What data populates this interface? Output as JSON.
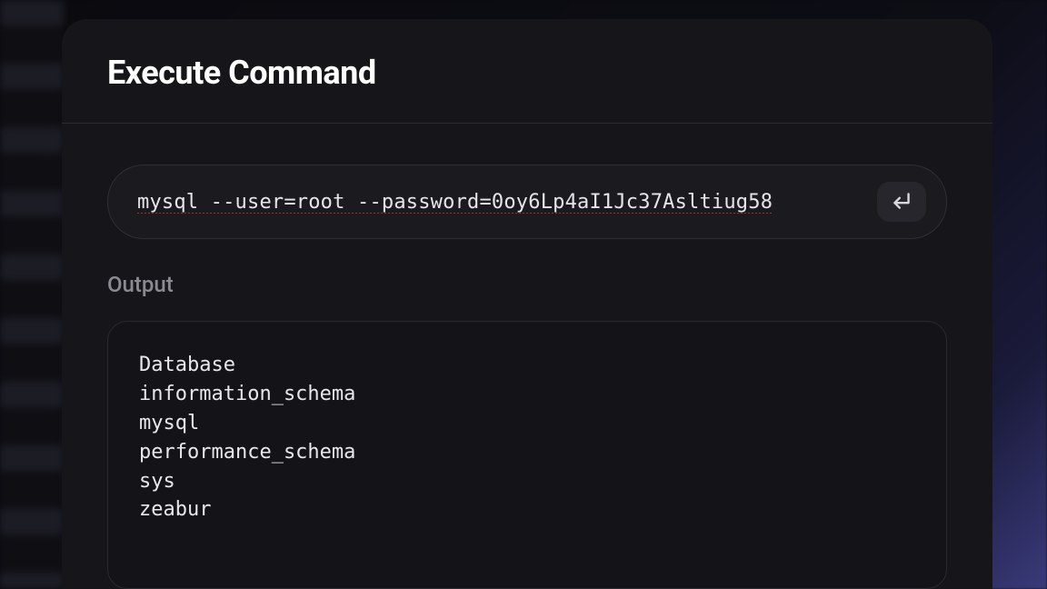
{
  "modal": {
    "title": "Execute Command"
  },
  "command": {
    "value": "mysql --user=root --password=0oy6Lp4aI1Jc37Asltiug58"
  },
  "output": {
    "label": "Output",
    "lines": [
      "Database",
      "information_schema",
      "mysql",
      "performance_schema",
      "sys",
      "zeabur"
    ]
  }
}
